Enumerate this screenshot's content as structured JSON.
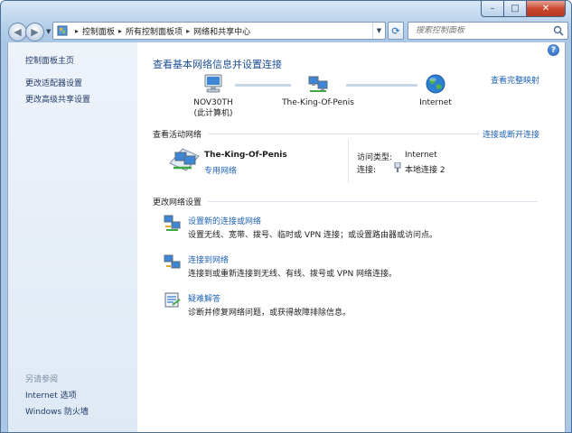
{
  "window": {
    "minimize_glyph": "–",
    "maximize_glyph": "□",
    "close_glyph": "✕"
  },
  "address": {
    "crumbs": [
      "控制面板",
      "所有控制面板项",
      "网络和共享中心"
    ],
    "separator": "▸"
  },
  "search": {
    "placeholder": "搜索控制面板"
  },
  "help_glyph": "?",
  "sidebar": {
    "items": [
      {
        "label": "控制面板主页"
      },
      {
        "label": "更改适配器设置"
      },
      {
        "label": "更改高级共享设置"
      }
    ],
    "see_also_heading": "另请参阅",
    "see_also": [
      {
        "label": "Internet 选项"
      },
      {
        "label": "Windows 防火墙"
      }
    ]
  },
  "main": {
    "title": "查看基本网络信息并设置连接",
    "full_map_link": "查看完整映射",
    "nodes": [
      {
        "line1": "NOV30TH",
        "line2": "(此计算机)",
        "icon": "computer-icon"
      },
      {
        "line1": "The-King-Of-Penis",
        "line2": "",
        "icon": "network-icon"
      },
      {
        "line1": "Internet",
        "line2": "",
        "icon": "globe-icon"
      }
    ],
    "active_networks_heading": "查看活动网络",
    "connect_disconnect_link": "连接或断开连接",
    "network": {
      "name": "The-King-Of-Penis",
      "type": "专用网络",
      "access_type_label": "访问类型:",
      "access_type_value": "Internet",
      "connections_label": "连接:",
      "connections_value": "本地连接 2"
    },
    "change_settings_heading": "更改网络设置",
    "tasks": [
      {
        "title": "设置新的连接或网络",
        "desc": "设置无线、宽带、拨号、临时或 VPN 连接；或设置路由器或访问点。",
        "icon": "new-connection-icon"
      },
      {
        "title": "连接到网络",
        "desc": "连接到或重新连接到无线、有线、拨号或 VPN 网络连接。",
        "icon": "connect-network-icon"
      },
      {
        "title": "疑难解答",
        "desc": "诊断并修复网络问题，或获得故障排除信息。",
        "icon": "troubleshoot-icon"
      }
    ]
  }
}
